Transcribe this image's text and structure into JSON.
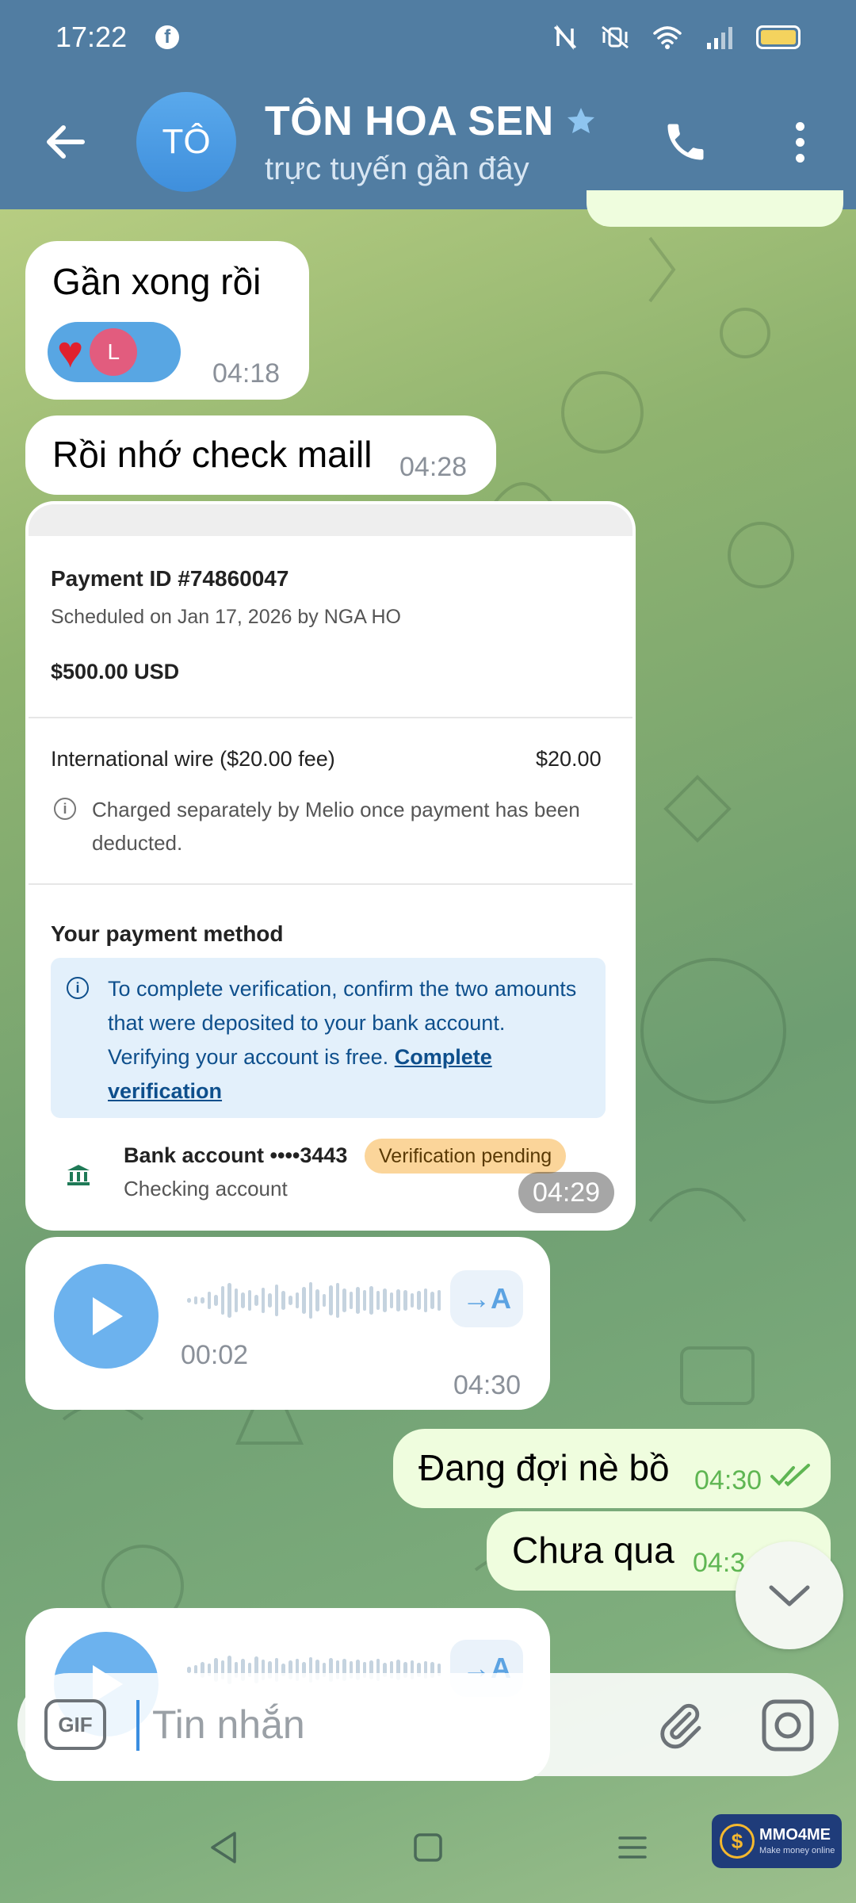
{
  "status_bar": {
    "time": "17:22"
  },
  "header": {
    "avatar_initials": "TÔ",
    "title": "TÔN HOA SEN",
    "subtitle": "trực tuyến gần đây"
  },
  "messages": {
    "m1": {
      "text": "Gần xong rồi",
      "time": "04:18",
      "reaction_user_initial": "L"
    },
    "m2": {
      "text": "Rồi nhớ check maill",
      "time": "04:28"
    },
    "screenshot": {
      "time": "04:29",
      "payment_id": "Payment ID #74860047",
      "scheduled": "Scheduled on Jan 17, 2026 by NGA HO",
      "amount": "$500.00 USD",
      "fee_label": "International wire ($20.00 fee)",
      "fee_value": "$20.00",
      "fee_note": "Charged separately by Melio once payment has been deducted.",
      "payment_method_title": "Your payment method",
      "verify_text": "To complete verification, confirm the two amounts that were deposited to your bank account. Verifying your account is free.",
      "verify_link": "Complete verification",
      "bank_name": "Bank account ••••3443",
      "bank_type": "Checking account",
      "status_badge": "Verification pending"
    },
    "voice1": {
      "duration": "00:02",
      "time": "04:30",
      "translate_label": "→A"
    },
    "o1": {
      "text": "Đang đợi nè bồ",
      "time": "04:30"
    },
    "o2": {
      "text": "Chưa qua",
      "time": "04:3"
    },
    "voice2": {
      "translate_label": "→A"
    }
  },
  "input": {
    "placeholder": "Tin nhắn",
    "gif_label": "GIF"
  },
  "watermark": {
    "title": "MMO4ME",
    "subtitle": "Make money online"
  },
  "colors": {
    "header": "#517da2",
    "accent": "#5ca3e2",
    "outgoing_bubble": "#effdde",
    "outgoing_meta": "#5fb653"
  }
}
